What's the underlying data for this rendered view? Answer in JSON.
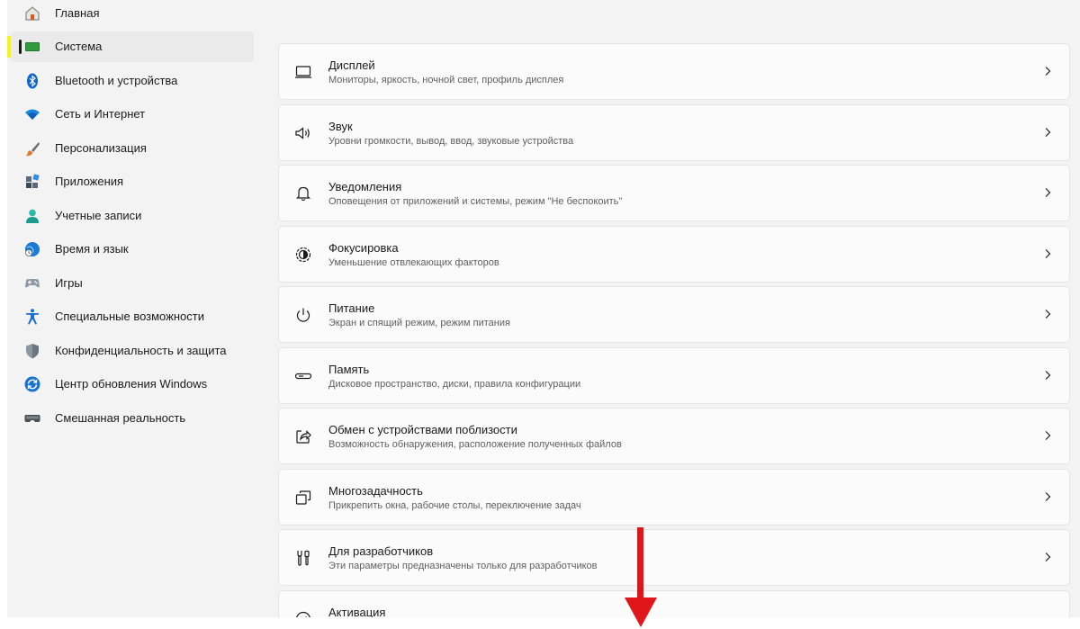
{
  "sidebar": {
    "items": [
      {
        "label": "Главная",
        "icon": "home-icon"
      },
      {
        "label": "Система",
        "icon": "system-monitor-icon"
      },
      {
        "label": "Bluetooth и устройства",
        "icon": "bluetooth-icon"
      },
      {
        "label": "Сеть и Интернет",
        "icon": "wifi-icon"
      },
      {
        "label": "Персонализация",
        "icon": "paintbrush-icon"
      },
      {
        "label": "Приложения",
        "icon": "apps-icon"
      },
      {
        "label": "Учетные записи",
        "icon": "user-icon"
      },
      {
        "label": "Время и язык",
        "icon": "globe-clock-icon"
      },
      {
        "label": "Игры",
        "icon": "gamepad-icon"
      },
      {
        "label": "Специальные возможности",
        "icon": "accessibility-icon"
      },
      {
        "label": "Конфиденциальность и защита",
        "icon": "shield-icon"
      },
      {
        "label": "Центр обновления Windows",
        "icon": "update-icon"
      },
      {
        "label": "Смешанная реальность",
        "icon": "vr-headset-icon"
      }
    ],
    "selected": "Система"
  },
  "main": {
    "cards": [
      {
        "title": "Дисплей",
        "subtitle": "Мониторы, яркость, ночной свет, профиль дисплея",
        "icon": "display-icon"
      },
      {
        "title": "Звук",
        "subtitle": "Уровни громкости, вывод, ввод, звуковые устройства",
        "icon": "speaker-icon"
      },
      {
        "title": "Уведомления",
        "subtitle": "Оповещения от приложений и системы, режим \"Не беспокоить\"",
        "icon": "bell-icon"
      },
      {
        "title": "Фокусировка",
        "subtitle": "Уменьшение отвлекающих факторов",
        "icon": "focus-icon"
      },
      {
        "title": "Питание",
        "subtitle": "Экран и спящий режим, режим питания",
        "icon": "power-icon"
      },
      {
        "title": "Память",
        "subtitle": "Дисковое пространство, диски, правила конфигурации",
        "icon": "storage-icon"
      },
      {
        "title": "Обмен с устройствами поблизости",
        "subtitle": "Возможность обнаружения, расположение полученных файлов",
        "icon": "share-icon"
      },
      {
        "title": "Многозадачность",
        "subtitle": "Прикрепить окна, рабочие столы, переключение задач",
        "icon": "multitask-icon"
      },
      {
        "title": "Для разработчиков",
        "subtitle": "Эти параметры предназначены только для разработчиков",
        "icon": "developer-tools-icon"
      },
      {
        "title": "Активация",
        "subtitle": "",
        "icon": "activation-icon"
      }
    ]
  },
  "colors": {
    "accent": "#0067c0",
    "highlight": "#f5f51a",
    "annotation_arrow": "#e0161b"
  }
}
